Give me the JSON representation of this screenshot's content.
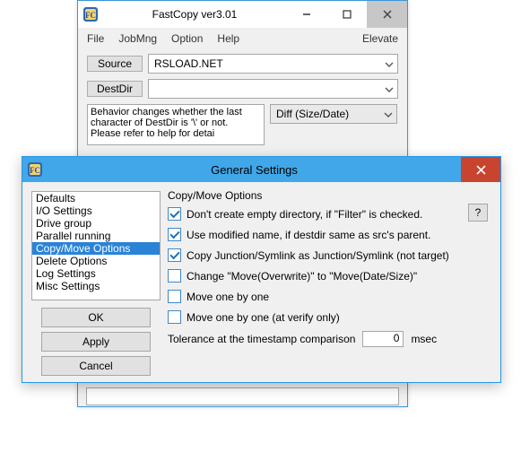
{
  "main": {
    "title": "FastCopy ver3.01",
    "menu": {
      "file": "File",
      "jobmng": "JobMng",
      "option": "Option",
      "help": "Help",
      "elevate": "Elevate"
    },
    "source_btn": "Source",
    "source_val": "RSLOAD.NET",
    "destdir_btn": "DestDir",
    "destdir_val": "",
    "behavior": "Behavior changes whether the last character of DestDir is '\\' or not. Please refer to help for detai",
    "diff_val": "Diff (Size/Date)"
  },
  "modal": {
    "title": "General Settings",
    "categories": {
      "defaults": "Defaults",
      "io": "I/O Settings",
      "drive": "Drive group",
      "parallel": "Parallel running",
      "copy": "Copy/Move Options",
      "delete": "Delete Options",
      "log": "Log Settings",
      "misc": "Misc Settings"
    },
    "buttons": {
      "ok": "OK",
      "apply": "Apply",
      "cancel": "Cancel",
      "help": "?"
    },
    "panel": {
      "heading": "Copy/Move Options",
      "opt1": "Don't create empty directory, if \"Filter\" is checked.",
      "opt2": "Use modified name, if destdir same as src's parent.",
      "opt3": "Copy Junction/Symlink as Junction/Symlink (not target)",
      "opt4": "Change \"Move(Overwrite)\" to \"Move(Date/Size)\"",
      "opt5": "Move one by one",
      "opt6": "Move one by one (at verify only)",
      "tol_label": "Tolerance at the timestamp comparison",
      "tol_value": "0",
      "tol_unit": "msec"
    }
  }
}
